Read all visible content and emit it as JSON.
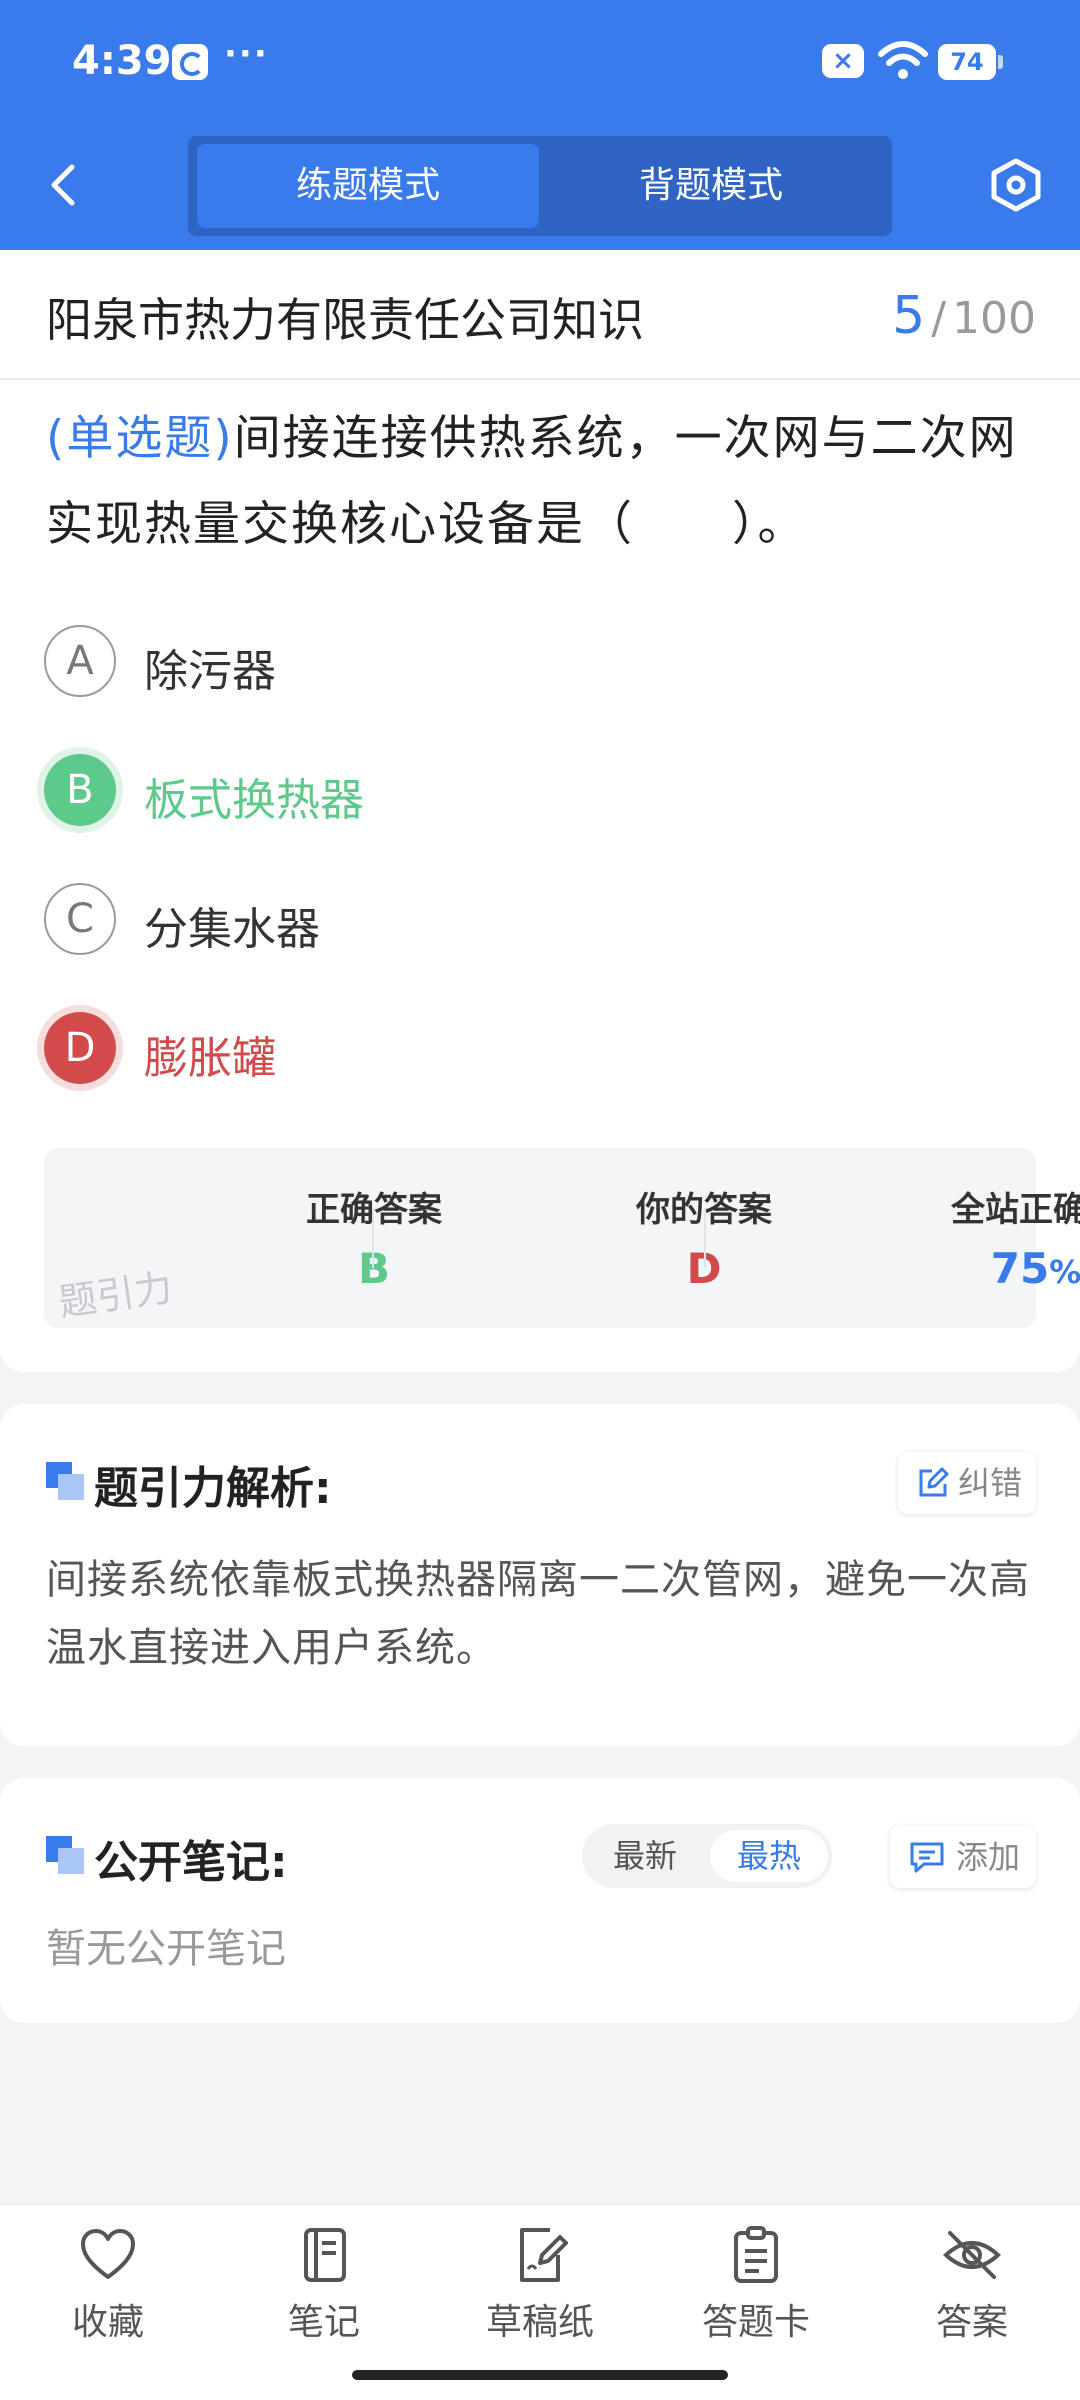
{
  "status_bar": {
    "time": "4:39",
    "more": "···",
    "battery": "74",
    "icons": [
      "app-icon",
      "dnd-icon",
      "wifi-icon",
      "battery-icon"
    ]
  },
  "header": {
    "back_icon": "chevron-left-icon",
    "modes": [
      "练题模式",
      "背题模式"
    ],
    "active_mode": "练题模式",
    "settings_icon": "hexagon-settings-icon",
    "color": "#3a7bec"
  },
  "subject": {
    "title": "阳泉市热力有限责任公司知识",
    "current": "5",
    "separator": "/",
    "total": "100"
  },
  "question": {
    "type": "(单选题)",
    "text": "间接连接供热系统，一次网与二次网实现热量交换核心设备是（　　）。",
    "options": [
      {
        "letter": "A",
        "text": "除污器",
        "state": "normal"
      },
      {
        "letter": "B",
        "text": "板式换热器",
        "state": "correct"
      },
      {
        "letter": "C",
        "text": "分集水器",
        "state": "normal"
      },
      {
        "letter": "D",
        "text": "膨胀罐",
        "state": "wrong"
      }
    ]
  },
  "stats": {
    "correct_label": "正确答案",
    "correct_value": "B",
    "yours_label": "你的答案",
    "yours_value": "D",
    "rate_label": "全站正确率",
    "rate_value": "75",
    "rate_unit": "%",
    "watermark": "题引力"
  },
  "analysis": {
    "title": "题引力解析:",
    "report_button": "纠错",
    "text": "间接系统依靠板式换热器隔离一二次管网，避免一次高温水直接进入用户系统。"
  },
  "notes": {
    "title": "公开笔记:",
    "sort_options": [
      "最新",
      "最热"
    ],
    "active_sort": "最热",
    "add_button": "添加",
    "empty_text": "暂无公开笔记"
  },
  "bottom_nav": [
    {
      "label": "收藏",
      "icon": "heart-icon"
    },
    {
      "label": "笔记",
      "icon": "notebook-icon"
    },
    {
      "label": "草稿纸",
      "icon": "draft-paper-icon"
    },
    {
      "label": "答题卡",
      "icon": "answer-sheet-icon"
    },
    {
      "label": "答案",
      "icon": "eye-off-icon"
    }
  ],
  "colors": {
    "accent": "#3a7bec",
    "correct": "#5dc98a",
    "wrong": "#d24a4a"
  }
}
